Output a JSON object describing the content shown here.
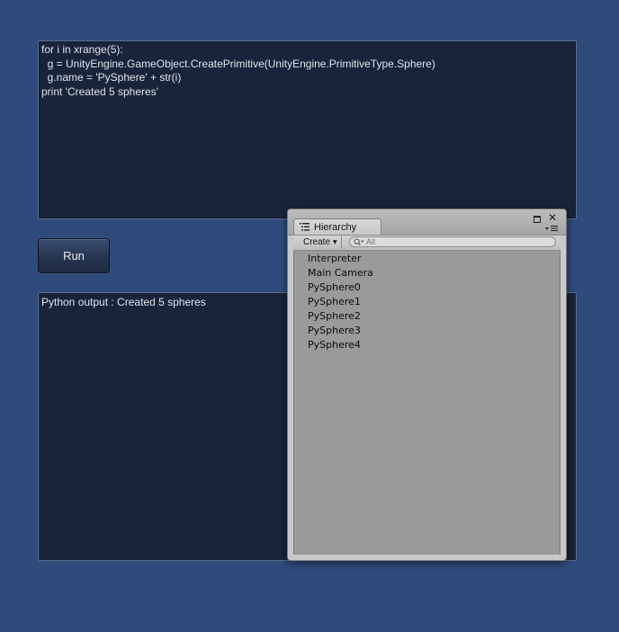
{
  "colors": {
    "background": "#2f4b7c",
    "panel": "#19243a",
    "panel_border": "#5a6e93",
    "hierarchy_list_bg": "#9a9a9a"
  },
  "editor": {
    "code": "for i in xrange(5):\n  g = UnityEngine.GameObject.CreatePrimitive(UnityEngine.PrimitiveType.Sphere)\n  g.name = 'PySphere' + str(i)\nprint 'Created 5 spheres'"
  },
  "run_button": {
    "label": "Run"
  },
  "output": {
    "text": "Python output : Created 5 spheres"
  },
  "hierarchy": {
    "tab_label": "Hierarchy",
    "tab_icon": "hierarchy-list-icon",
    "create_label": "Create",
    "search_placeholder": "All",
    "items": [
      {
        "label": "Interpreter"
      },
      {
        "label": "Main Camera"
      },
      {
        "label": "PySphere0"
      },
      {
        "label": "PySphere1"
      },
      {
        "label": "PySphere2"
      },
      {
        "label": "PySphere3"
      },
      {
        "label": "PySphere4"
      }
    ]
  }
}
